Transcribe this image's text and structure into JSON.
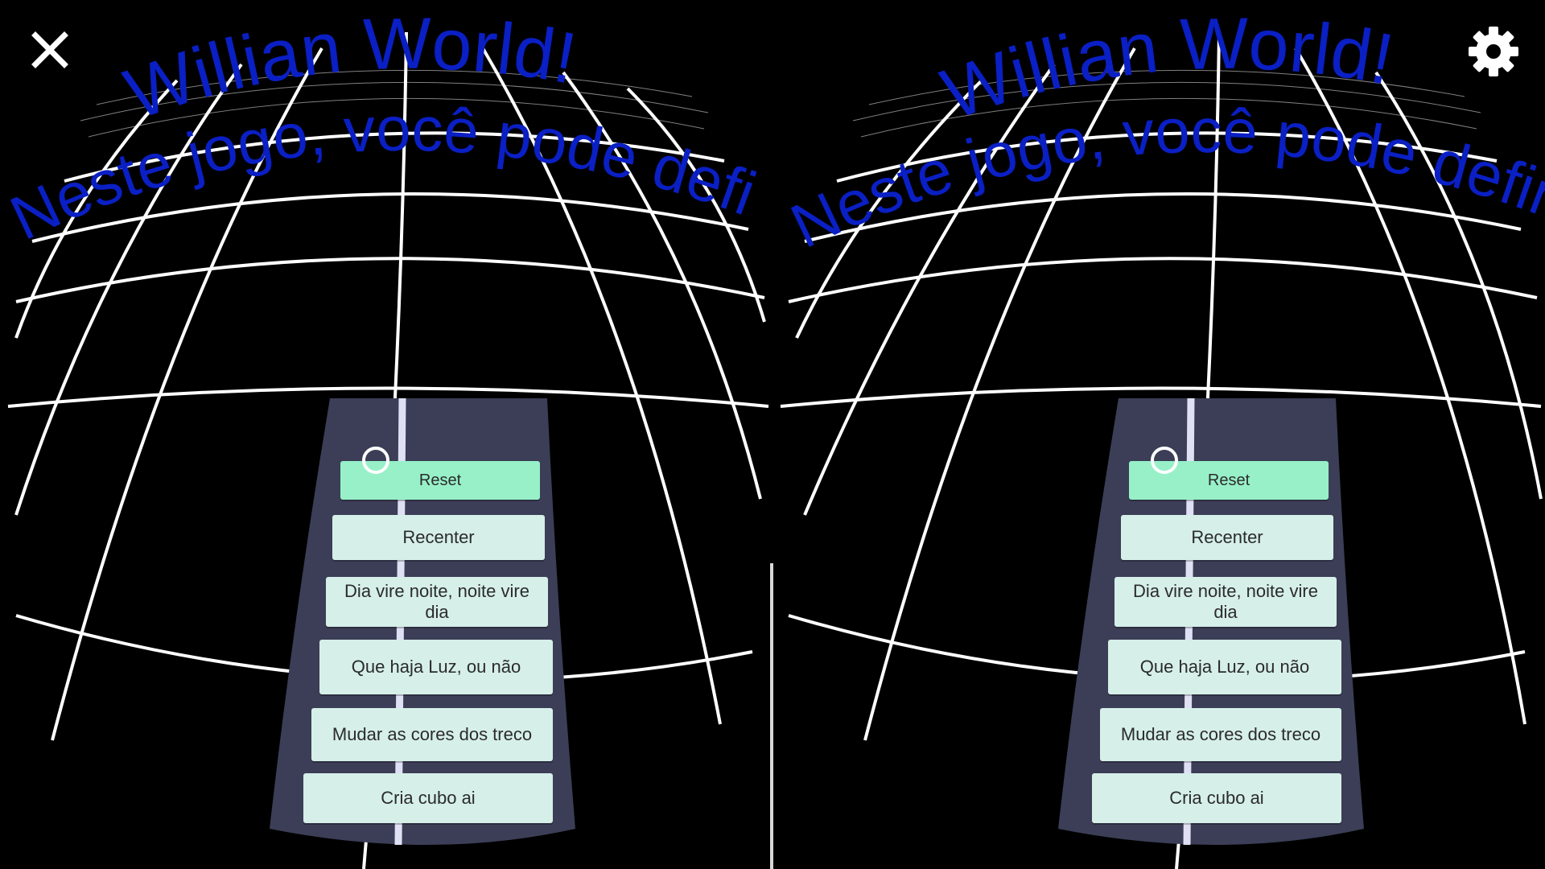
{
  "scene": {
    "title_text": "Willian World!",
    "subtitle_text": "Neste jogo, você pode definir",
    "text_color": "#0a1fc4",
    "panel_color": "#3b3e56",
    "grid_color": "#ffffff"
  },
  "toolbar": {
    "close_icon": "close-icon",
    "settings_icon": "gear-icon"
  },
  "menu": {
    "buttons": [
      {
        "label": "Reset",
        "highlighted": true
      },
      {
        "label": "Recenter",
        "highlighted": false
      },
      {
        "label": "Dia vire noite, noite vire dia",
        "highlighted": false
      },
      {
        "label": "Que haja Luz, ou não",
        "highlighted": false
      },
      {
        "label": "Mudar as cores dos treco",
        "highlighted": false
      },
      {
        "label": "Cria cubo ai",
        "highlighted": false
      }
    ]
  },
  "colors": {
    "button_bg": "#d6efe9",
    "button_active_bg": "#98f0c8"
  }
}
